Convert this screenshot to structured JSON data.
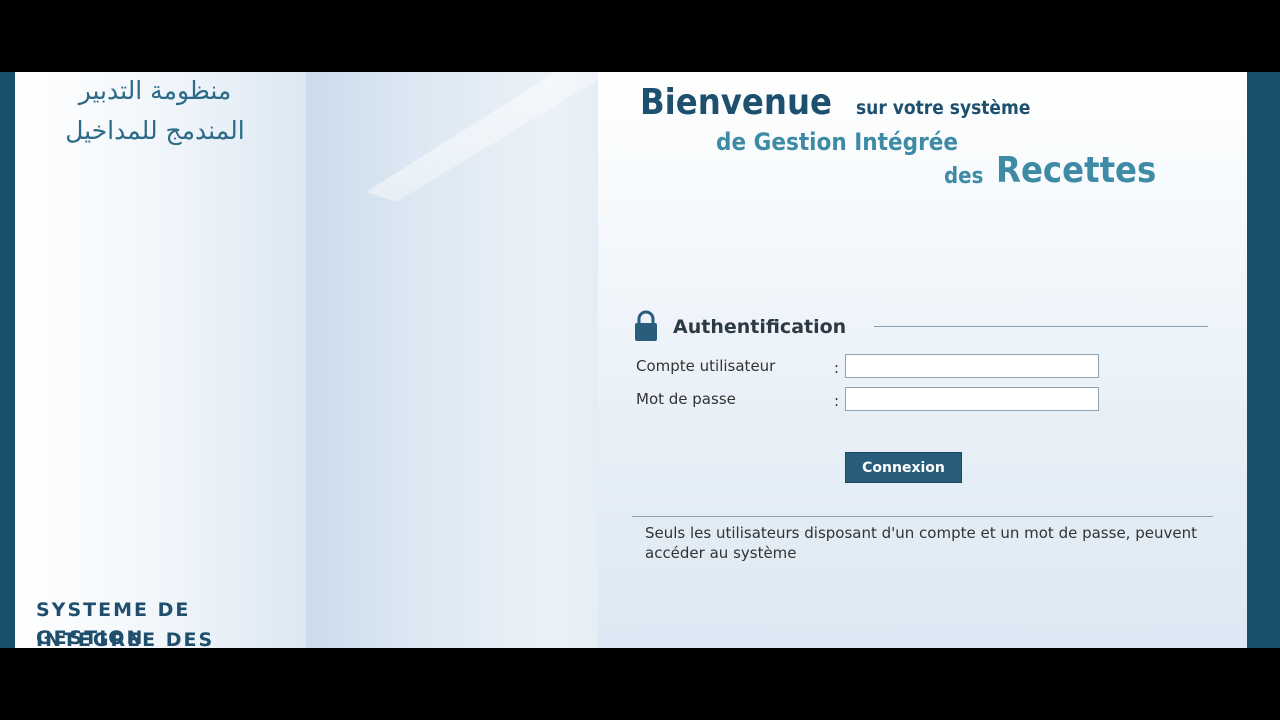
{
  "branding": {
    "arabic_line1": "منظومة التدبير",
    "arabic_line2": "المندمج للمداخيل",
    "system_title_line1": "SYSTEME DE GESTION",
    "system_title_line2": "INTEGREE DES RECETTES"
  },
  "welcome": {
    "word_bienvenue": "Bienvenue",
    "text_sur": "sur votre système",
    "text_line2": "de Gestion Intégrée",
    "text_des": "des",
    "word_recettes": "Recettes"
  },
  "auth": {
    "icon": "lock-icon",
    "title": "Authentification",
    "user_label": "Compte utilisateur",
    "user_value": "",
    "pass_label": "Mot de passe",
    "pass_value": "",
    "colon": ":",
    "submit_label": "Connexion",
    "note": "Seuls les utilisateurs disposant d'un compte et un mot de passe, peuvent accéder au système"
  },
  "colors": {
    "frame_dark": "#1b4f6e",
    "title_dark": "#1d506e",
    "title_light": "#3f8ba6",
    "button": "#2a5d7c"
  }
}
